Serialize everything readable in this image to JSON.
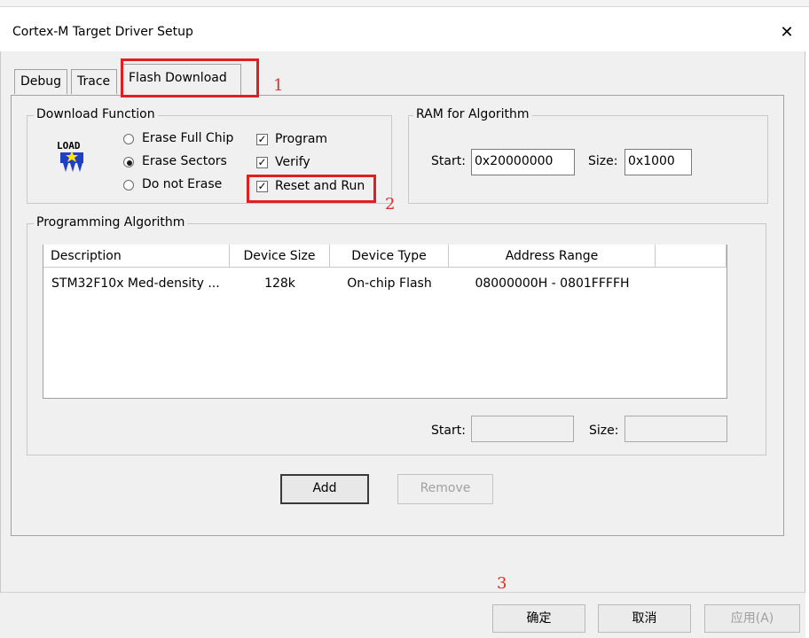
{
  "window": {
    "title": "Cortex-M Target Driver Setup",
    "close_glyph": "✕"
  },
  "tabs": [
    {
      "label": "Debug",
      "active": false
    },
    {
      "label": "Trace",
      "active": false
    },
    {
      "label": "Flash Download",
      "active": true
    }
  ],
  "annotations": {
    "one": "1",
    "two": "2",
    "three": "3",
    "color": "#e02020"
  },
  "download_function": {
    "legend": "Download Function",
    "icon_text": "LOAD",
    "erase_options": [
      {
        "label": "Erase Full Chip",
        "checked": false
      },
      {
        "label": "Erase Sectors",
        "checked": true
      },
      {
        "label": "Do not Erase",
        "checked": false
      }
    ],
    "checks": [
      {
        "label": "Program",
        "checked": true
      },
      {
        "label": "Verify",
        "checked": true
      },
      {
        "label": "Reset and Run",
        "checked": true
      }
    ],
    "check_glyph": "✓"
  },
  "ram": {
    "legend": "RAM for Algorithm",
    "start_label": "Start:",
    "start_value": "0x20000000",
    "size_label": "Size:",
    "size_value": "0x1000"
  },
  "algorithm": {
    "legend": "Programming Algorithm",
    "columns": [
      "Description",
      "Device Size",
      "Device Type",
      "Address Range"
    ],
    "rows": [
      {
        "description": "STM32F10x Med-density ...",
        "device_size": "128k",
        "device_type": "On-chip Flash",
        "address_range": "08000000H - 0801FFFFH"
      }
    ],
    "start_label": "Start:",
    "start_value": "",
    "size_label": "Size:",
    "size_value": ""
  },
  "buttons": {
    "add": "Add",
    "remove": "Remove"
  },
  "footer": {
    "ok": "确定",
    "cancel": "取消",
    "apply": "应用(A)"
  }
}
